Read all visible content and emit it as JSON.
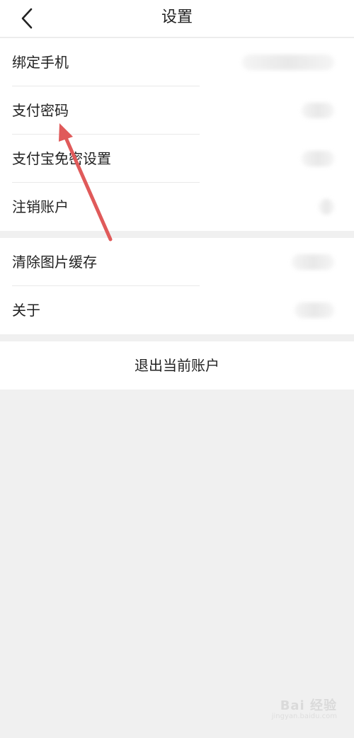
{
  "header": {
    "title": "设置",
    "back_icon": "chevron-left-icon"
  },
  "section1": {
    "items": [
      {
        "label": "绑定手机"
      },
      {
        "label": "支付密码"
      },
      {
        "label": "支付宝免密设置"
      },
      {
        "label": "注销账户"
      }
    ]
  },
  "section2": {
    "items": [
      {
        "label": "清除图片缓存"
      },
      {
        "label": "关于"
      }
    ]
  },
  "logout": {
    "label": "退出当前账户"
  },
  "watermark": {
    "main": "Bai 经验",
    "sub": "jingyan.baidu.com"
  },
  "colors": {
    "background": "#f0f0f0",
    "card": "#ffffff",
    "divider": "#e9e9e9",
    "text": "#222222",
    "annotation_arrow": "#e05a5a"
  }
}
